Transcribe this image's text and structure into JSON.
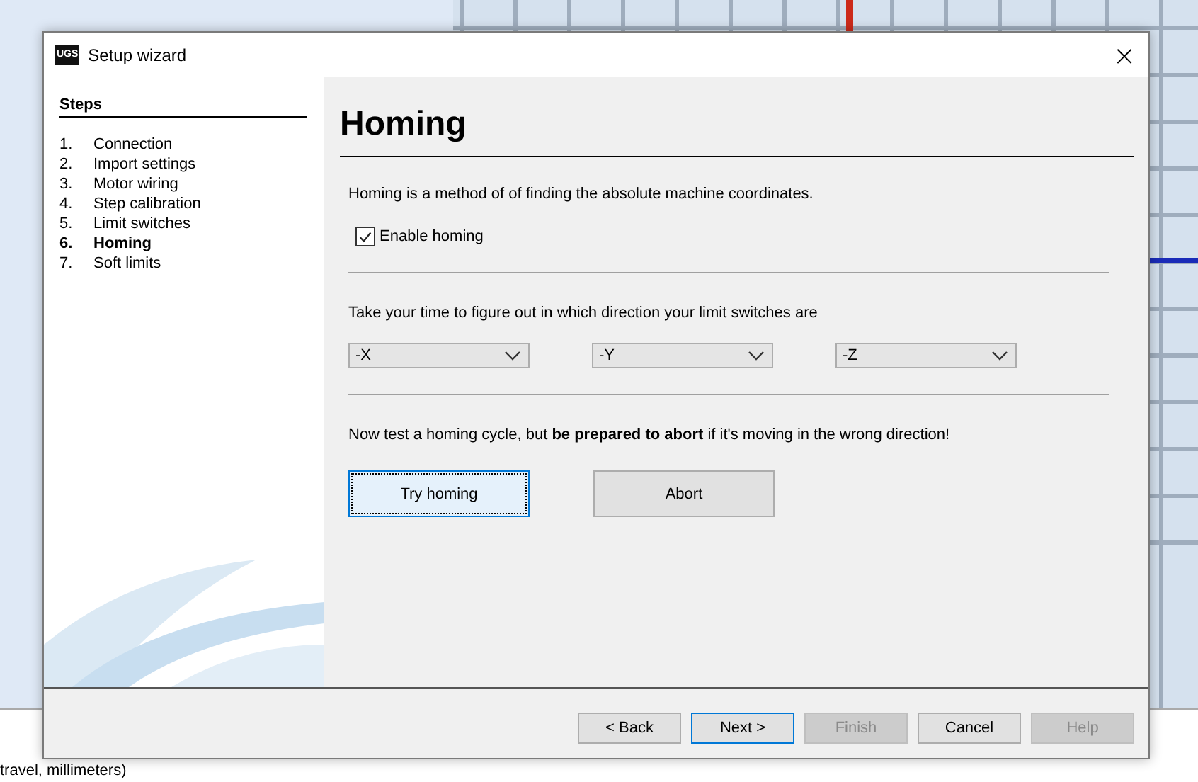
{
  "background": {
    "log_line": "travel, millimeters)"
  },
  "window": {
    "title": "Setup wizard",
    "logo": "UGS",
    "close": "×"
  },
  "steps": {
    "heading": "Steps",
    "items": [
      {
        "number": "1.",
        "label": "Connection",
        "selected": false
      },
      {
        "number": "2.",
        "label": "Import settings",
        "selected": false
      },
      {
        "number": "3.",
        "label": "Motor wiring",
        "selected": false
      },
      {
        "number": "4.",
        "label": "Step calibration",
        "selected": false
      },
      {
        "number": "5.",
        "label": "Limit switches",
        "selected": false
      },
      {
        "number": "6.",
        "label": "Homing",
        "selected": true
      },
      {
        "number": "7.",
        "label": "Soft limits",
        "selected": false
      }
    ]
  },
  "page": {
    "title": "Homing",
    "intro": "Homing is a method of of finding the absolute machine coordinates.",
    "enable_homing": {
      "label": "Enable homing",
      "checked": true
    },
    "direction_text": "Take your time to figure out in which direction your limit switches are",
    "directions": [
      {
        "value": "-X"
      },
      {
        "value": "-Y"
      },
      {
        "value": "-Z"
      }
    ],
    "test_text": "Now test a homing cycle, but **be prepared to abort** if it's moving in the wrong direction!",
    "test_buttons": [
      {
        "label": "Try homing",
        "focused": true
      },
      {
        "label": "Abort",
        "focused": false
      }
    ]
  },
  "buttons": [
    {
      "label": "< Back",
      "disabled": false,
      "default": false
    },
    {
      "label": "Next >",
      "disabled": false,
      "default": true
    },
    {
      "label": "Finish",
      "disabled": true,
      "default": false
    },
    {
      "label": "Cancel",
      "disabled": false,
      "default": false
    },
    {
      "label": "Help",
      "disabled": true,
      "default": false
    }
  ]
}
